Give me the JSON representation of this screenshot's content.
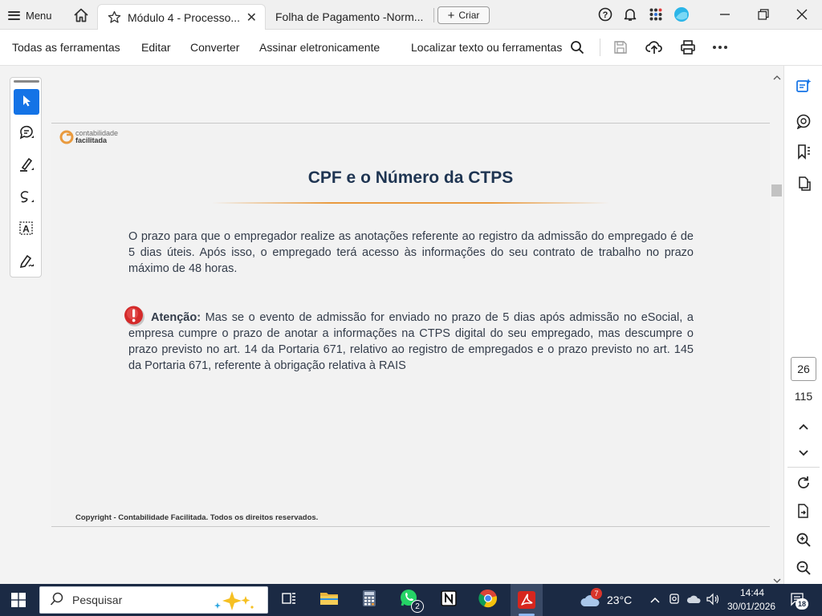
{
  "titlebar": {
    "menu_label": "Menu",
    "tabs": [
      {
        "label": "Módulo 4 - Processo...",
        "close": "✕"
      },
      {
        "label": "Folha de Pagamento -Norm..."
      }
    ],
    "new_button": "Criar"
  },
  "toolbar": {
    "all_tools": "Todas as ferramentas",
    "edit": "Editar",
    "convert": "Converter",
    "sign": "Assinar eletronicamente",
    "find": "Localizar texto ou ferramentas"
  },
  "document": {
    "logo_line1": "contabilidade",
    "logo_line2": "facilitada",
    "title": "CPF e o Número da CTPS",
    "paragraph1": "O prazo para que o empregador realize as anotações referente ao registro da admissão do empregado é  de 5 dias úteis. Após isso, o empregado terá acesso às informações do seu contrato de trabalho no prazo máximo de 48 horas.",
    "attention_label": "Atenção:",
    "paragraph2": " Mas se o evento de admissão for enviado no prazo de 5 dias após admissão no eSocial, a empresa cumpre o prazo de anotar a informações na CTPS digital do seu empregado, mas descumpre o prazo previsto no art. 14 da Portaria 671, relativo ao registro de empregados e o prazo previsto no art. 145 da Portaria 671, referente à obrigação relativa à RAIS",
    "footer": "Copyright - Contabilidade Facilitada. Todos os direitos reservados."
  },
  "pagination": {
    "current_page": "26",
    "total_pages": "115"
  },
  "taskbar": {
    "search_placeholder": "Pesquisar",
    "whatsapp_badge": "2",
    "weather_badge": "7",
    "temperature": "23°C",
    "time": "14:44",
    "date": "30/01/2026",
    "notification_count": "18"
  },
  "colors": {
    "accent": "#1473e6",
    "title_color": "#1f3552",
    "taskbar": "#1b2a44",
    "acrobat_red": "#d7261e",
    "orange_line": "#e99a3e"
  }
}
